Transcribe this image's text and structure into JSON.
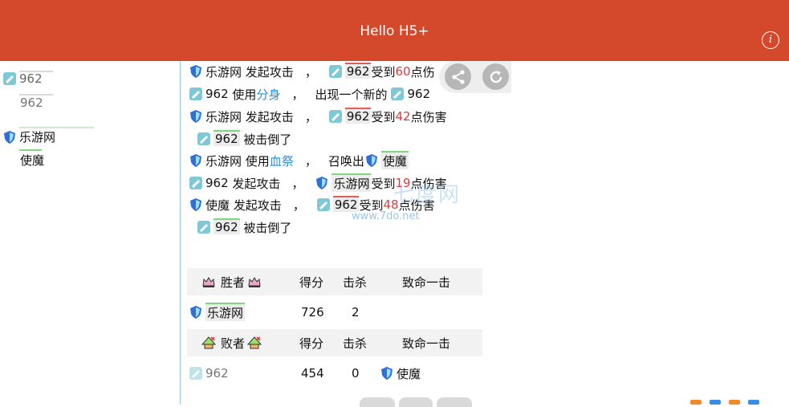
{
  "header": {
    "title": "Hello H5+",
    "info_icon": "info-icon"
  },
  "sidebar": {
    "team1": {
      "name": "962",
      "sub": "962"
    },
    "team2": {
      "name": "乐游网",
      "sub": "使魔"
    }
  },
  "log": [
    {
      "actor": "乐游网",
      "verb": "发起攻击",
      "sep": "，",
      "target": "962",
      "recv": "受到",
      "dmg": "60",
      "dmg_suffix": "点伤"
    },
    {
      "actor": "962",
      "verb": "使用",
      "skill": "分身",
      "sep": "，",
      "text": "出现一个新的",
      "target": "962"
    },
    {
      "actor": "乐游网",
      "verb": "发起攻击",
      "sep": "，",
      "target": "962",
      "recv": "受到",
      "dmg": "42",
      "dmg_suffix": "点伤害"
    },
    {
      "actor": "962",
      "text": "被击倒了"
    },
    {
      "actor": "乐游网",
      "verb": "使用",
      "skill": "血祭",
      "sep": "，",
      "text": "召唤出",
      "target": "使魔"
    },
    {
      "actor": "962",
      "verb": "发起攻击",
      "sep": "，",
      "target": "乐游网",
      "recv": "受到",
      "dmg": "19",
      "dmg_suffix": "点伤害"
    },
    {
      "actor": "使魔",
      "verb": "发起攻击",
      "sep": "，",
      "target": "962",
      "recv": "受到",
      "dmg": "48",
      "dmg_suffix": "点伤害"
    },
    {
      "actor": "962",
      "text": "被击倒了"
    }
  ],
  "watermark": {
    "text1": "七度网",
    "text2": "www.7do.net"
  },
  "results": {
    "winner_label": "胜者",
    "loser_label": "败者",
    "col_score": "得分",
    "col_kills": "击杀",
    "col_final": "致命一击",
    "winner_row": {
      "name": "乐游网",
      "score": "726",
      "kills": "2",
      "final": ""
    },
    "loser_row": {
      "name": "962",
      "score": "454",
      "kills": "0",
      "final": "使魔"
    }
  },
  "colors": {
    "header": "#d4492b",
    "damage": "#e03a3a",
    "skill": "#2a8fd6",
    "hp": "#7fd67f"
  }
}
